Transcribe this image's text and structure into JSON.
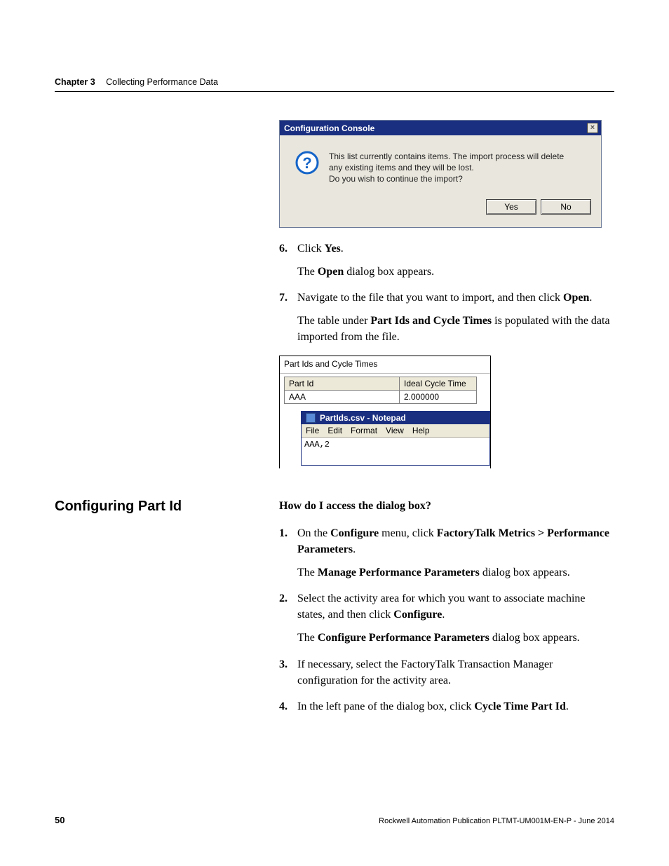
{
  "header": {
    "chapter_label": "Chapter 3",
    "chapter_title": "Collecting Performance Data"
  },
  "dialog1": {
    "title": "Configuration Console",
    "close_glyph": "×",
    "message_l1": "This list currently contains items. The import process will delete",
    "message_l2": "any existing items and they will be lost.",
    "message_l3": "Do you wish to continue the import?",
    "yes": "Yes",
    "no": "No"
  },
  "steps_a": {
    "s6_pre": "Click ",
    "s6_b": "Yes",
    "s6_post": ".",
    "s6_follow_pre": "The ",
    "s6_follow_b": "Open",
    "s6_follow_post": " dialog box appears.",
    "s7_pre": "Navigate to the file that you want to import, and then click ",
    "s7_b": "Open",
    "s7_post": ".",
    "s7_follow_pre": "The table under ",
    "s7_follow_b": "Part Ids and Cycle Times",
    "s7_follow_post": " is populated with the data imported from the file."
  },
  "fig2": {
    "group_label": "Part Ids and Cycle Times",
    "col1": "Part Id",
    "col2": "Ideal Cycle Time",
    "r1c1": "AAA",
    "r1c2": "2.000000",
    "notepad_title": "PartIds.csv - Notepad",
    "menu": {
      "file": "File",
      "edit": "Edit",
      "format": "Format",
      "view": "View",
      "help": "Help"
    },
    "notepad_body": "AAA,2"
  },
  "side_heading": "Configuring Part Id",
  "prompt": "How do I access the dialog box?",
  "steps_b": {
    "s1_pre": "On the ",
    "s1_b1": "Configure",
    "s1_mid": " menu, click ",
    "s1_b2": "FactoryTalk Metrics > Performance Parameters",
    "s1_post": ".",
    "s1_follow_pre": "The ",
    "s1_follow_b": "Manage Performance Parameters",
    "s1_follow_post": " dialog box appears.",
    "s2_pre": "Select the activity area for which you want to associate machine states, and then click ",
    "s2_b": "Configure",
    "s2_post": ".",
    "s2_follow_pre": "The ",
    "s2_follow_b": "Configure Performance Parameters",
    "s2_follow_post": " dialog box appears.",
    "s3": "If necessary, select the FactoryTalk Transaction Manager configuration for the activity area.",
    "s4_pre": "In the left pane of the dialog box, click ",
    "s4_b": "Cycle Time Part Id",
    "s4_post": "."
  },
  "footer": {
    "page": "50",
    "pub": "Rockwell Automation Publication PLTMT-UM001M-EN-P - June 2014"
  }
}
